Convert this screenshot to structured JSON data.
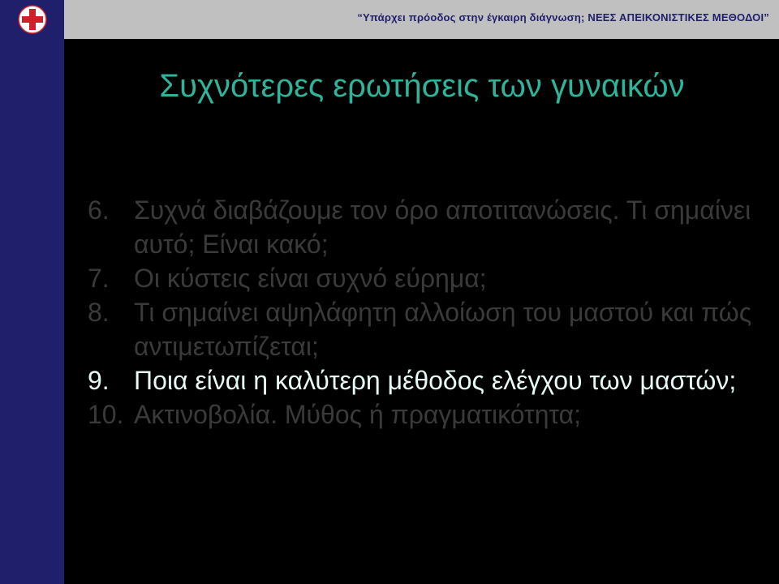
{
  "header": {
    "text": "“Υπάρχει πρόοδος στην έγκαιρη διάγνωση;  ΝΕΕΣ ΑΠΕΙΚΟΝΙΣΤΙΚΕΣ  ΜΕΘΟΔΟΙ”"
  },
  "logo": {
    "icon": "red-cross-logo-icon"
  },
  "colors": {
    "background": "#000000",
    "sidebar": "#1f1f6b",
    "header": "#c0c0c0",
    "title": "#2fb39a",
    "dim_item": "#3a3a3a",
    "active_item": "#e6fbf6"
  },
  "title": "Συχνότερες ερωτήσεις των γυναικών",
  "items": [
    {
      "num": "6.",
      "text": "Συχνά διαβάζουμε τον όρο αποτιτανώσεις.  Τι σημαίνει αυτό;  Είναι κακό;"
    },
    {
      "num": "7.",
      "text": "Οι κύστεις είναι συχνό εύρημα;"
    },
    {
      "num": "8.",
      "text": "Τι σημαίνει αψηλάφητη αλλοίωση του μαστού και πώς αντιμετωπίζεται;"
    },
    {
      "num": "9.",
      "text": "Ποια είναι η καλύτερη μέθοδος ελέγχου των μαστών;"
    },
    {
      "num": "10.",
      "text": "Ακτινοβολία.  Μύθος ή πραγματικότητα;"
    }
  ]
}
